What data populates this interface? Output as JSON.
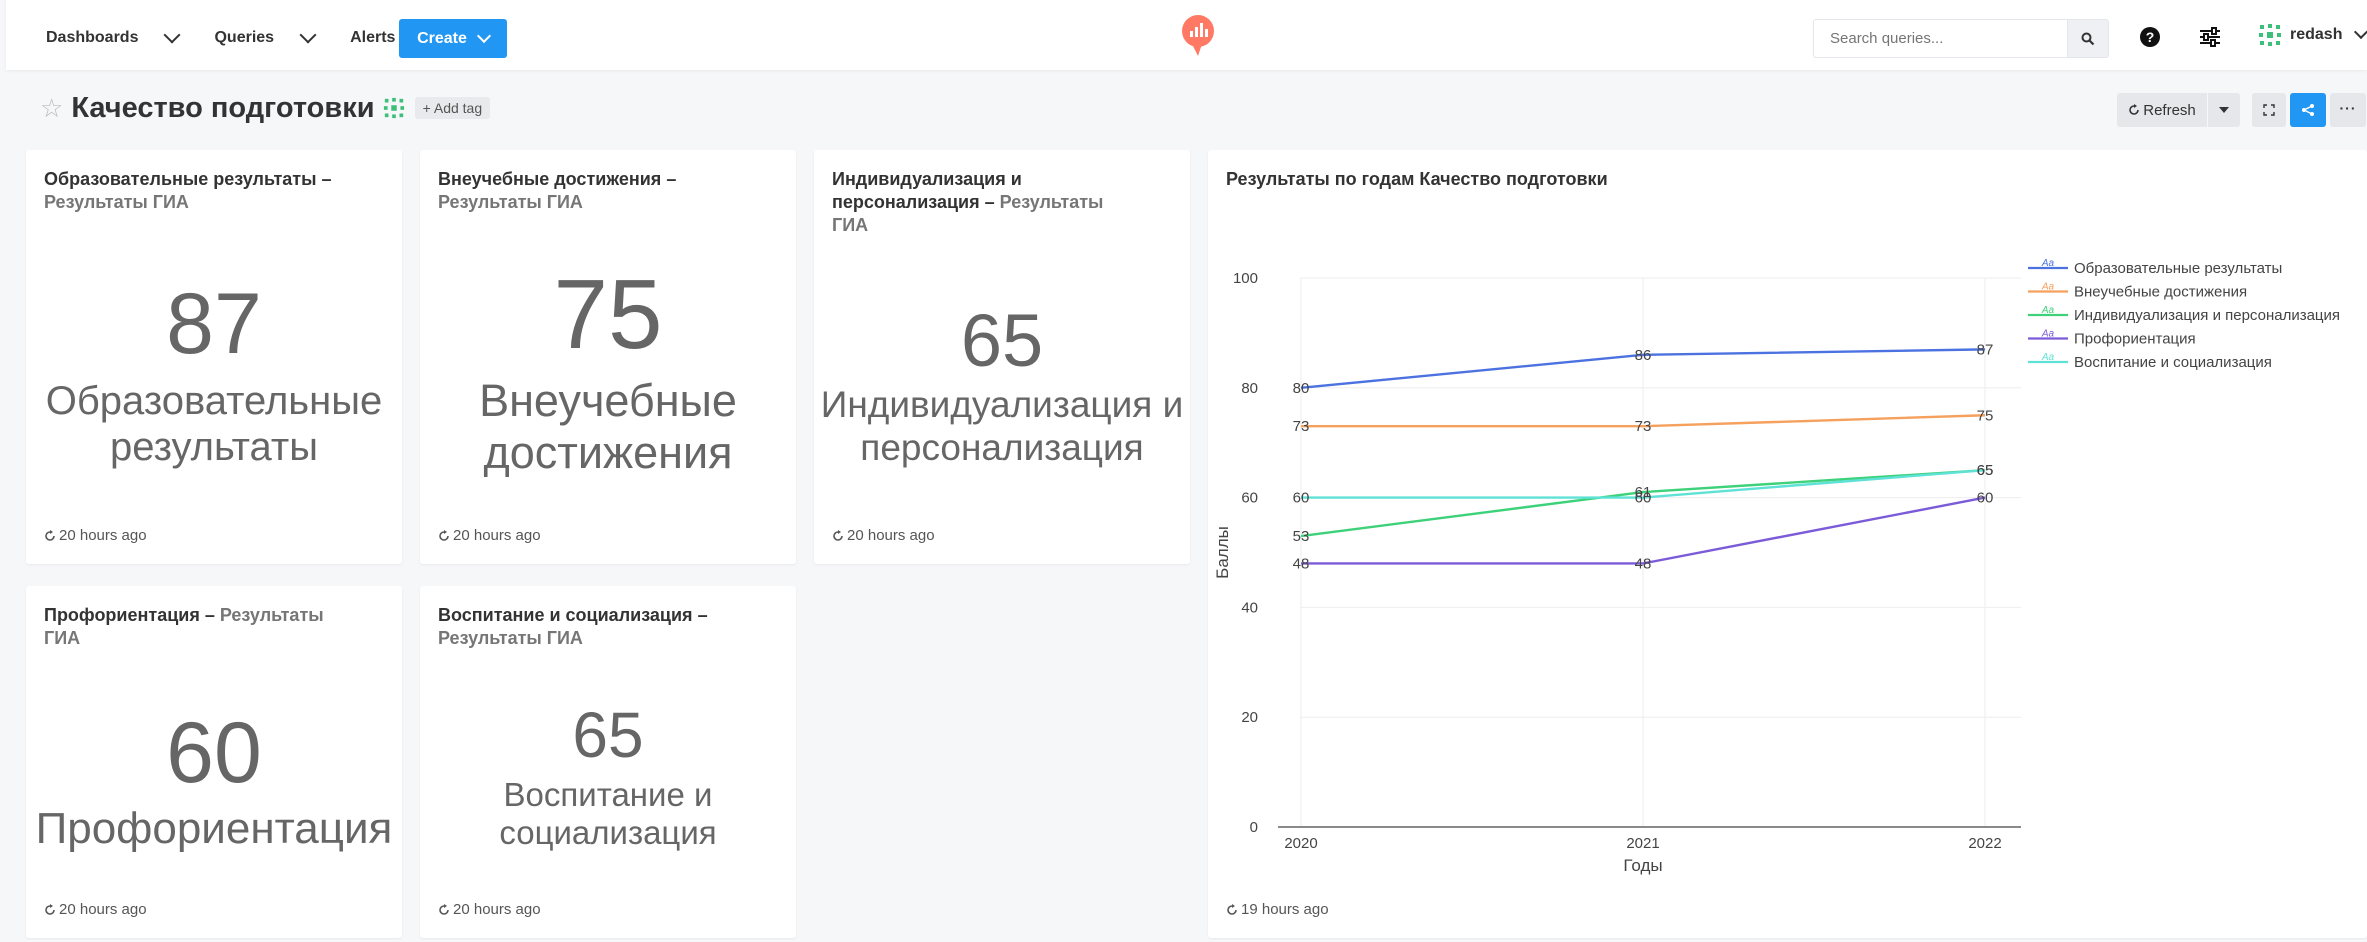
{
  "nav": {
    "dashboards": "Dashboards",
    "queries": "Queries",
    "alerts": "Alerts",
    "create": "Create"
  },
  "search": {
    "placeholder": "Search queries..."
  },
  "user": {
    "name": "redash"
  },
  "dashboard": {
    "title": "Качество подготовки",
    "add_tag": "+ Add tag",
    "refresh": "Refresh"
  },
  "widgets": [
    {
      "title": "Образовательные результаты",
      "sep": " – ",
      "source": "Результаты ГИА",
      "value": "87",
      "label": "Образовательные результаты",
      "updated": "20 hours ago"
    },
    {
      "title": "Внеучебные достижения",
      "sep": " – ",
      "source": "Результаты ГИА",
      "value": "75",
      "label": "Внеучебные достижения",
      "updated": "20 hours ago"
    },
    {
      "title": "Индивидуализация и персонализация",
      "sep": " – ",
      "source": "Результаты ГИА",
      "value": "65",
      "label": "Индивидуализация и персонализация",
      "updated": "20 hours ago"
    },
    {
      "title": "Профориентация",
      "sep": " – ",
      "source": "Результаты ГИА",
      "value": "60",
      "label": "Профориентация",
      "updated": "20 hours ago"
    },
    {
      "title": "Воспитание и социализация",
      "sep": " – ",
      "source": "Результаты ГИА",
      "value": "65",
      "label": "Воспитание и социализация",
      "updated": "20 hours ago"
    }
  ],
  "chart_widget": {
    "title": "Результаты по годам Качество подготовки",
    "updated": "19 hours ago",
    "legend_marker": "Aa"
  },
  "chart_data": {
    "type": "line",
    "title": "Результаты по годам Качество подготовки",
    "xlabel": "Годы",
    "ylabel": "Баллы",
    "x": [
      "2020",
      "2021",
      "2022"
    ],
    "ylim": [
      0,
      100
    ],
    "yticks": [
      0,
      20,
      40,
      60,
      80,
      100
    ],
    "grid": true,
    "legend_position": "right",
    "series": [
      {
        "name": "Образовательные результаты",
        "values": [
          80,
          86,
          87
        ],
        "color": "#4b72e0"
      },
      {
        "name": "Внеучебные достижения",
        "values": [
          73,
          73,
          75
        ],
        "color": "#f5a05c"
      },
      {
        "name": "Индивидуализация и персонализация",
        "values": [
          53,
          61,
          65
        ],
        "color": "#3dd17a"
      },
      {
        "name": "Профориентация",
        "values": [
          48,
          48,
          60
        ],
        "color": "#7c5bd9"
      },
      {
        "name": "Воспитание и социализация",
        "values": [
          60,
          60,
          65
        ],
        "color": "#5fe2d6"
      }
    ]
  },
  "colors": {
    "accent": "#2196f3",
    "logo": "#ff7964",
    "avatar": "#3dbf7a"
  }
}
